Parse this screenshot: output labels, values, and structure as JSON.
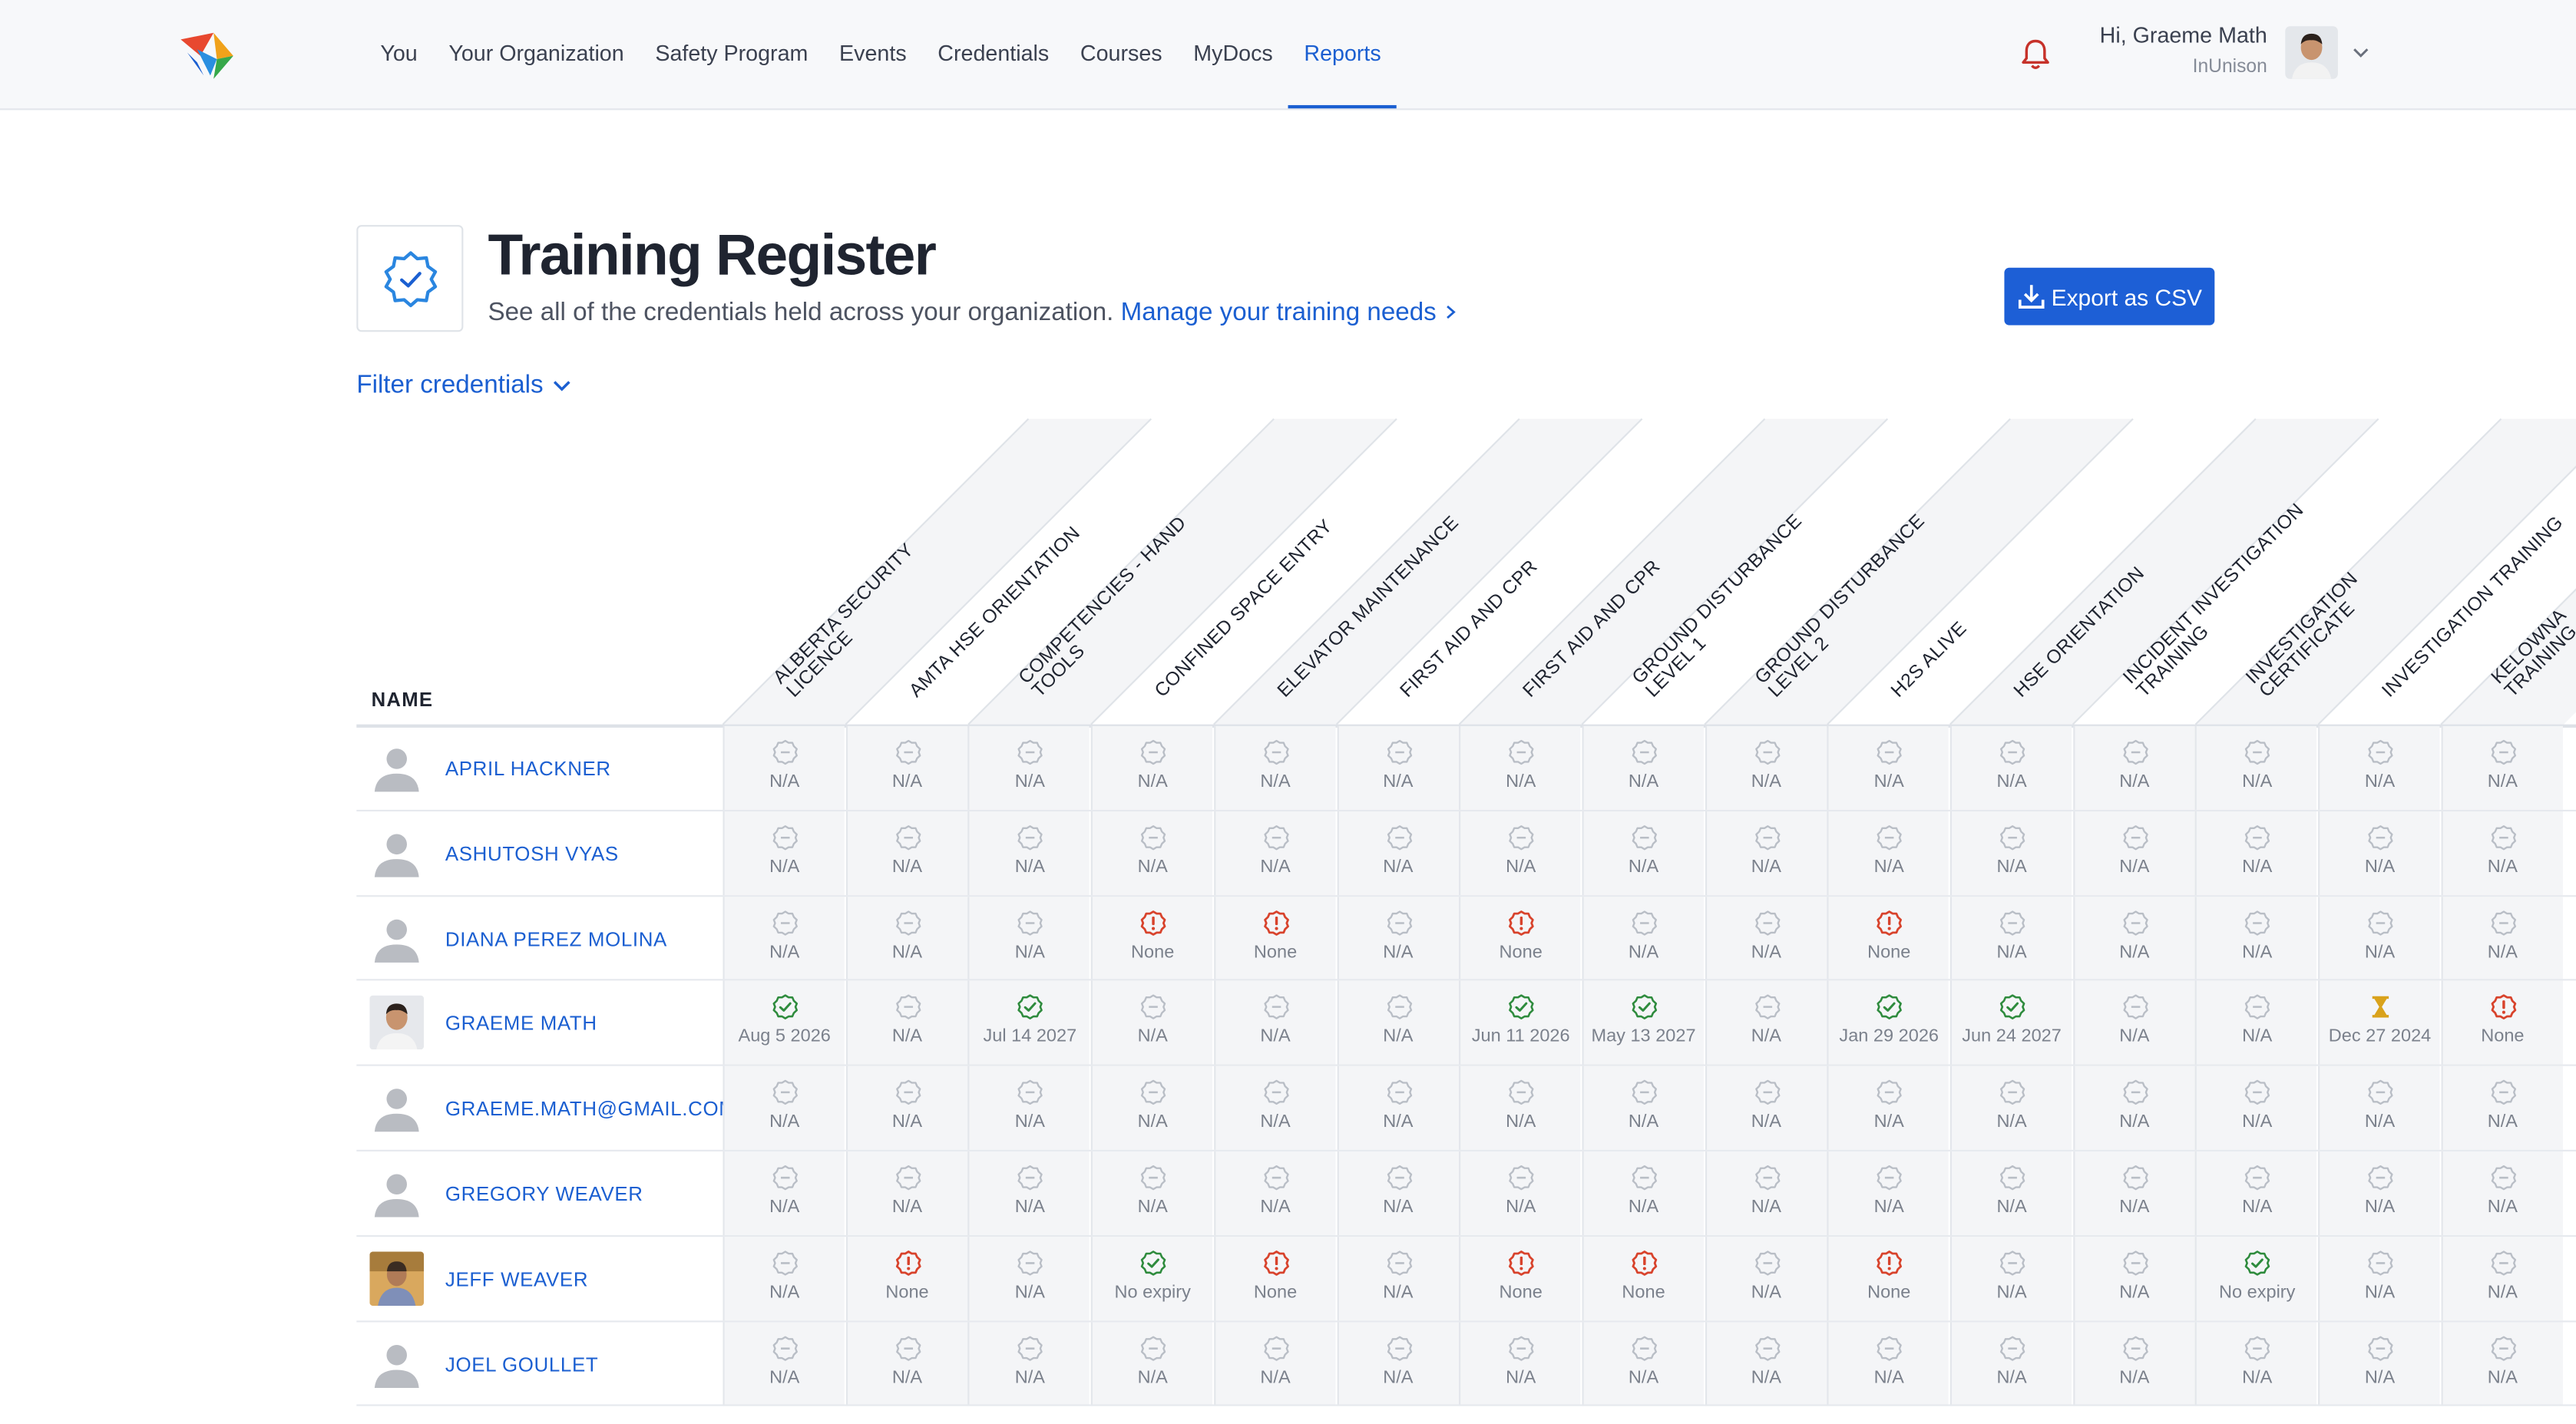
{
  "nav": {
    "items": [
      "You",
      "Your Organization",
      "Safety Program",
      "Events",
      "Credentials",
      "Courses",
      "MyDocs",
      "Reports"
    ],
    "active_index": 7
  },
  "user": {
    "greeting": "Hi, Graeme Math",
    "org": "InUnison"
  },
  "page": {
    "title": "Training Register",
    "subtitle": "See all of the credentials held across your organization.",
    "manage_link": "Manage your training needs",
    "export_label": "Export as CSV",
    "filter_label": "Filter credentials"
  },
  "colors": {
    "accent": "#1b5fd1",
    "valid": "#2e8b3d",
    "expired": "#d8432c",
    "pending": "#d9a21b",
    "na": "#b9bec6"
  },
  "table": {
    "name_header": "NAME",
    "columns": [
      [
        "ALBERTA SECURITY",
        "LICENCE"
      ],
      [
        "AMTA HSE ORIENTATION"
      ],
      [
        "COMPETENCIES - HAND",
        "TOOLS"
      ],
      [
        "CONFINED SPACE ENTRY"
      ],
      [
        "ELEVATOR MAINTENANCE"
      ],
      [
        "FIRST AID AND CPR"
      ],
      [
        "FIRST AID AND CPR"
      ],
      [
        "GROUND DISTURBANCE",
        "LEVEL 1"
      ],
      [
        "GROUND DISTURBANCE",
        "LEVEL 2"
      ],
      [
        "H2S ALIVE"
      ],
      [
        "HSE ORIENTATION"
      ],
      [
        "INCIDENT INVESTIGATION",
        "TRAINING"
      ],
      [
        "INVESTIGATION",
        "CERTIFICATE"
      ],
      [
        "INVESTIGATION TRAINING"
      ],
      [
        "KELOWNA",
        "TRAINING"
      ]
    ],
    "rows": [
      {
        "name": "APRIL HACKNER",
        "avatar": "default-avatar",
        "cells": [
          [
            "na",
            "N/A"
          ],
          [
            "na",
            "N/A"
          ],
          [
            "na",
            "N/A"
          ],
          [
            "na",
            "N/A"
          ],
          [
            "na",
            "N/A"
          ],
          [
            "na",
            "N/A"
          ],
          [
            "na",
            "N/A"
          ],
          [
            "na",
            "N/A"
          ],
          [
            "na",
            "N/A"
          ],
          [
            "na",
            "N/A"
          ],
          [
            "na",
            "N/A"
          ],
          [
            "na",
            "N/A"
          ],
          [
            "na",
            "N/A"
          ],
          [
            "na",
            "N/A"
          ],
          [
            "na",
            "N/A"
          ]
        ]
      },
      {
        "name": "ASHUTOSH VYAS",
        "avatar": "default-avatar",
        "cells": [
          [
            "na",
            "N/A"
          ],
          [
            "na",
            "N/A"
          ],
          [
            "na",
            "N/A"
          ],
          [
            "na",
            "N/A"
          ],
          [
            "na",
            "N/A"
          ],
          [
            "na",
            "N/A"
          ],
          [
            "na",
            "N/A"
          ],
          [
            "na",
            "N/A"
          ],
          [
            "na",
            "N/A"
          ],
          [
            "na",
            "N/A"
          ],
          [
            "na",
            "N/A"
          ],
          [
            "na",
            "N/A"
          ],
          [
            "na",
            "N/A"
          ],
          [
            "na",
            "N/A"
          ],
          [
            "na",
            "N/A"
          ]
        ]
      },
      {
        "name": "DIANA PEREZ MOLINA",
        "avatar": "default-avatar",
        "cells": [
          [
            "na",
            "N/A"
          ],
          [
            "na",
            "N/A"
          ],
          [
            "na",
            "N/A"
          ],
          [
            "expired",
            "None"
          ],
          [
            "expired",
            "None"
          ],
          [
            "na",
            "N/A"
          ],
          [
            "expired",
            "None"
          ],
          [
            "na",
            "N/A"
          ],
          [
            "na",
            "N/A"
          ],
          [
            "expired",
            "None"
          ],
          [
            "na",
            "N/A"
          ],
          [
            "na",
            "N/A"
          ],
          [
            "na",
            "N/A"
          ],
          [
            "na",
            "N/A"
          ],
          [
            "na",
            "N/A"
          ]
        ]
      },
      {
        "name": "GRAEME MATH",
        "avatar": "photo-avatar",
        "cells": [
          [
            "valid",
            "Aug 5 2026"
          ],
          [
            "na",
            "N/A"
          ],
          [
            "valid",
            "Jul 14 2027"
          ],
          [
            "na",
            "N/A"
          ],
          [
            "na",
            "N/A"
          ],
          [
            "na",
            "N/A"
          ],
          [
            "valid",
            "Jun 11 2026"
          ],
          [
            "valid",
            "May 13 2027"
          ],
          [
            "na",
            "N/A"
          ],
          [
            "valid",
            "Jan 29 2026"
          ],
          [
            "valid",
            "Jun 24 2027"
          ],
          [
            "na",
            "N/A"
          ],
          [
            "na",
            "N/A"
          ],
          [
            "pending",
            "Dec 27 2024"
          ],
          [
            "expired",
            "None"
          ]
        ]
      },
      {
        "name": "GRAEME.MATH@GMAIL.COM",
        "avatar": "default-avatar",
        "cells": [
          [
            "na",
            "N/A"
          ],
          [
            "na",
            "N/A"
          ],
          [
            "na",
            "N/A"
          ],
          [
            "na",
            "N/A"
          ],
          [
            "na",
            "N/A"
          ],
          [
            "na",
            "N/A"
          ],
          [
            "na",
            "N/A"
          ],
          [
            "na",
            "N/A"
          ],
          [
            "na",
            "N/A"
          ],
          [
            "na",
            "N/A"
          ],
          [
            "na",
            "N/A"
          ],
          [
            "na",
            "N/A"
          ],
          [
            "na",
            "N/A"
          ],
          [
            "na",
            "N/A"
          ],
          [
            "na",
            "N/A"
          ]
        ]
      },
      {
        "name": "GREGORY WEAVER",
        "avatar": "default-avatar",
        "cells": [
          [
            "na",
            "N/A"
          ],
          [
            "na",
            "N/A"
          ],
          [
            "na",
            "N/A"
          ],
          [
            "na",
            "N/A"
          ],
          [
            "na",
            "N/A"
          ],
          [
            "na",
            "N/A"
          ],
          [
            "na",
            "N/A"
          ],
          [
            "na",
            "N/A"
          ],
          [
            "na",
            "N/A"
          ],
          [
            "na",
            "N/A"
          ],
          [
            "na",
            "N/A"
          ],
          [
            "na",
            "N/A"
          ],
          [
            "na",
            "N/A"
          ],
          [
            "na",
            "N/A"
          ],
          [
            "na",
            "N/A"
          ]
        ]
      },
      {
        "name": "JEFF WEAVER",
        "avatar": "photo-avatar",
        "cells": [
          [
            "na",
            "N/A"
          ],
          [
            "expired",
            "None"
          ],
          [
            "na",
            "N/A"
          ],
          [
            "valid",
            "No expiry"
          ],
          [
            "expired",
            "None"
          ],
          [
            "na",
            "N/A"
          ],
          [
            "expired",
            "None"
          ],
          [
            "expired",
            "None"
          ],
          [
            "na",
            "N/A"
          ],
          [
            "expired",
            "None"
          ],
          [
            "na",
            "N/A"
          ],
          [
            "na",
            "N/A"
          ],
          [
            "valid",
            "No expiry"
          ],
          [
            "na",
            "N/A"
          ],
          [
            "na",
            "N/A"
          ]
        ]
      },
      {
        "name": "JOEL GOULLET",
        "avatar": "default-avatar",
        "cells": [
          [
            "na",
            "N/A"
          ],
          [
            "na",
            "N/A"
          ],
          [
            "na",
            "N/A"
          ],
          [
            "na",
            "N/A"
          ],
          [
            "na",
            "N/A"
          ],
          [
            "na",
            "N/A"
          ],
          [
            "na",
            "N/A"
          ],
          [
            "na",
            "N/A"
          ],
          [
            "na",
            "N/A"
          ],
          [
            "na",
            "N/A"
          ],
          [
            "na",
            "N/A"
          ],
          [
            "na",
            "N/A"
          ],
          [
            "na",
            "N/A"
          ],
          [
            "na",
            "N/A"
          ],
          [
            "na",
            "N/A"
          ]
        ]
      }
    ]
  }
}
